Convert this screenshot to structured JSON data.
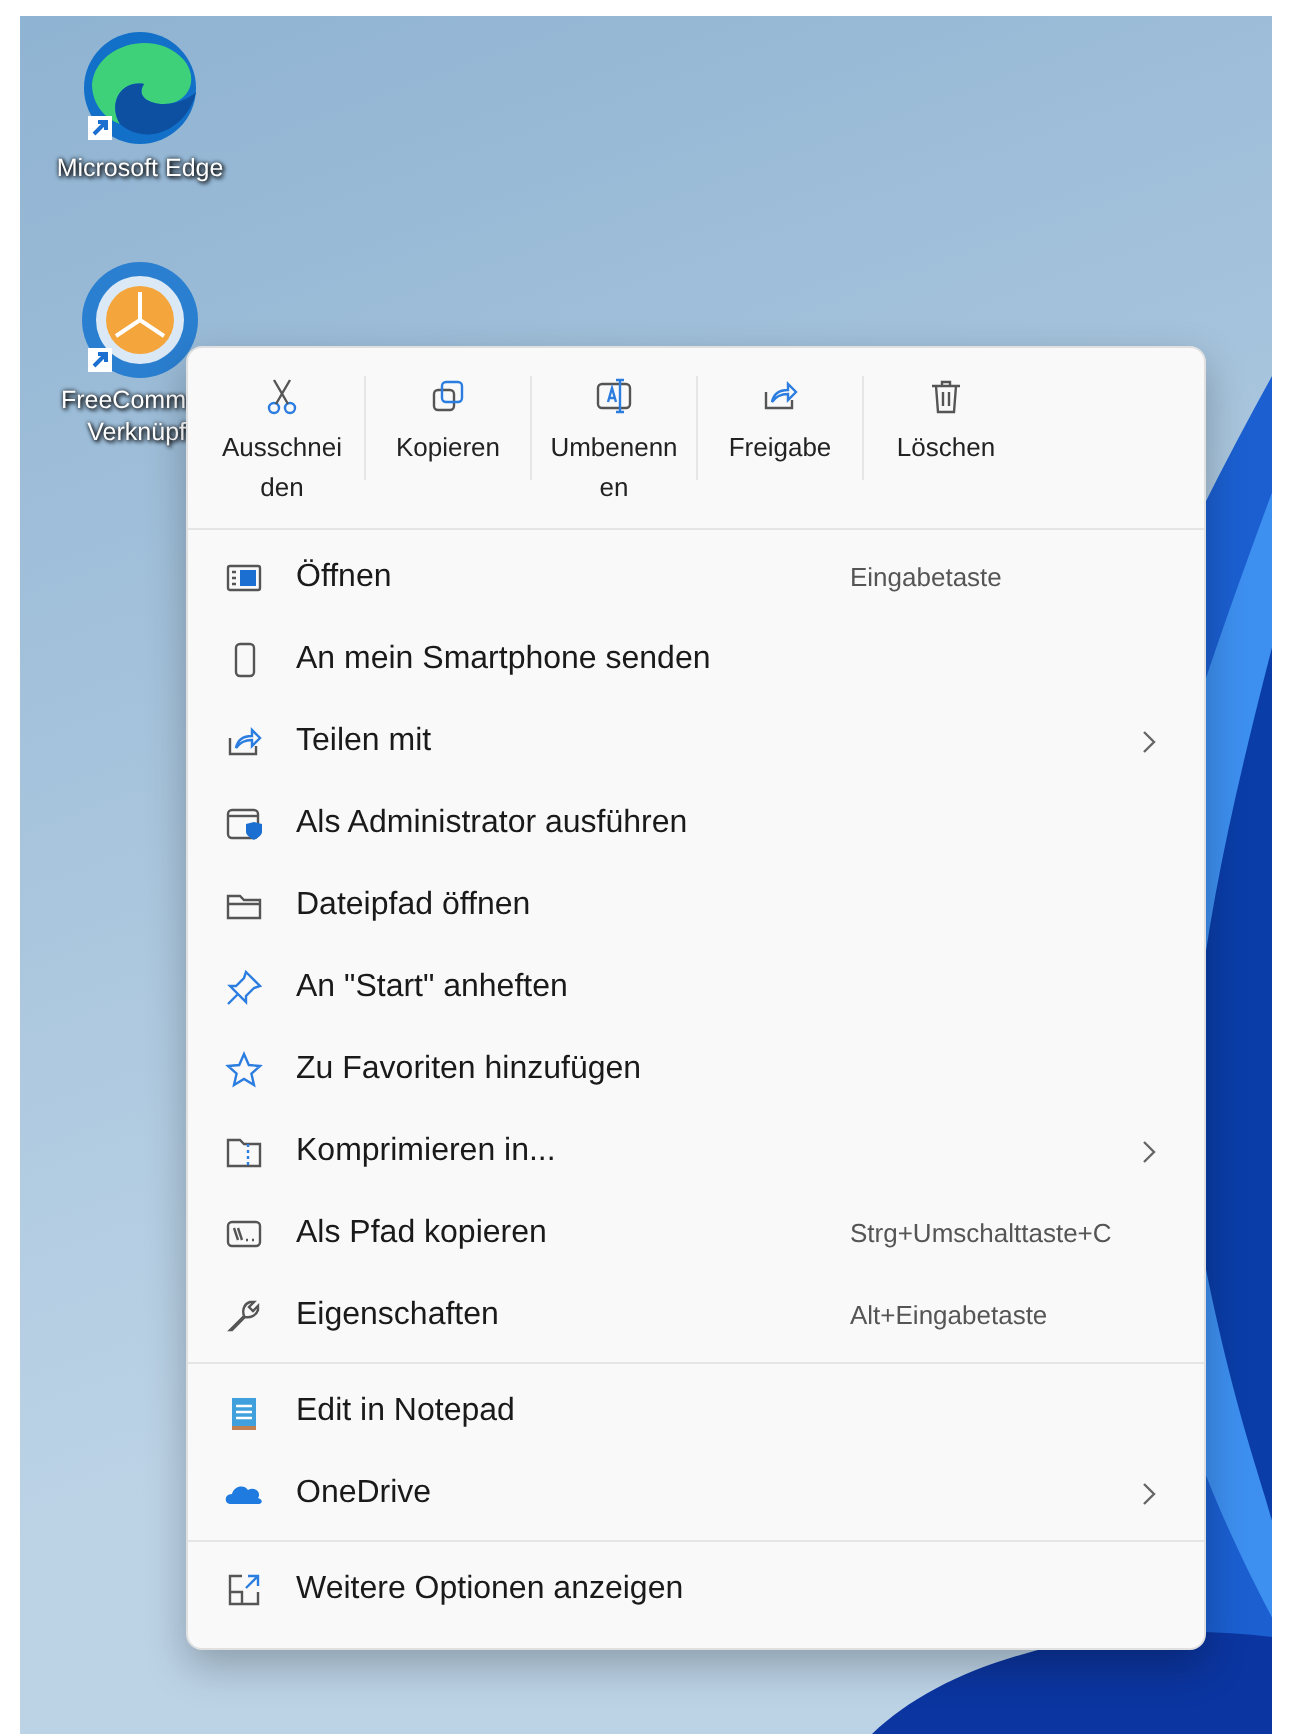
{
  "desktop_icons": [
    {
      "label_lines": [
        "Microsoft Edge"
      ]
    },
    {
      "label_lines": [
        "FreeComm",
        "Verknüpf"
      ]
    }
  ],
  "context_menu": {
    "toolbar": [
      {
        "label": "Ausschneiden"
      },
      {
        "label": "Kopieren"
      },
      {
        "label": "Umbenennen"
      },
      {
        "label": "Freigabe"
      },
      {
        "label": "Löschen"
      }
    ],
    "sections": [
      [
        {
          "label": "Öffnen",
          "shortcut": "Eingabetaste",
          "submenu": false
        },
        {
          "label": "An mein Smartphone senden",
          "submenu": false
        },
        {
          "label": "Teilen mit",
          "submenu": true
        },
        {
          "label": "Als Administrator ausführen",
          "submenu": false
        },
        {
          "label": "Dateipfad öffnen",
          "submenu": false
        },
        {
          "label": "An \"Start\" anheften",
          "submenu": false
        },
        {
          "label": "Zu Favoriten hinzufügen",
          "submenu": false
        },
        {
          "label": "Komprimieren in...",
          "submenu": true
        },
        {
          "label": "Als Pfad kopieren",
          "shortcut": "Strg+Umschalttaste+C",
          "submenu": false
        },
        {
          "label": "Eigenschaften",
          "shortcut": "Alt+Eingabetaste",
          "submenu": false
        }
      ],
      [
        {
          "label": "Edit in Notepad",
          "submenu": false
        },
        {
          "label": "OneDrive",
          "submenu": true
        }
      ],
      [
        {
          "label": "Weitere Optionen anzeigen",
          "submenu": false
        }
      ]
    ]
  }
}
